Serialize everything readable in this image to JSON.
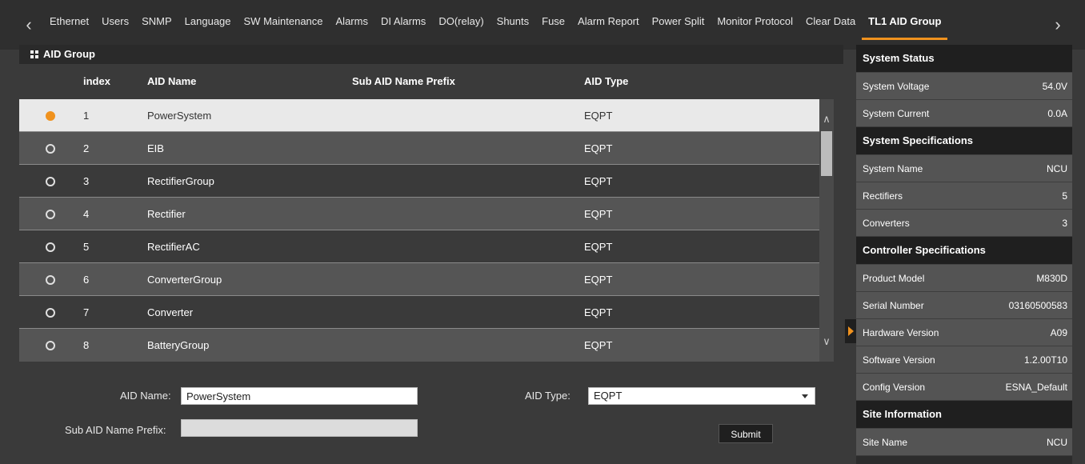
{
  "tabs": [
    {
      "label": "Ethernet"
    },
    {
      "label": "Users"
    },
    {
      "label": "SNMP"
    },
    {
      "label": "Language"
    },
    {
      "label": "SW Maintenance"
    },
    {
      "label": "Alarms"
    },
    {
      "label": "DI Alarms"
    },
    {
      "label": "DO(relay)"
    },
    {
      "label": "Shunts"
    },
    {
      "label": "Fuse"
    },
    {
      "label": "Alarm Report"
    },
    {
      "label": "Power Split"
    },
    {
      "label": "Monitor Protocol"
    },
    {
      "label": "Clear Data"
    },
    {
      "label": "TL1 AID Group"
    }
  ],
  "active_tab": "TL1 AID Group",
  "accent_color": "#f0921e",
  "group": {
    "title": "AID Group",
    "columns": {
      "index": "index",
      "aid_name": "AID Name",
      "sub_prefix": "Sub AID Name Prefix",
      "aid_type": "AID Type"
    },
    "rows": [
      {
        "index": "1",
        "name": "PowerSystem",
        "prefix": "",
        "type": "EQPT"
      },
      {
        "index": "2",
        "name": "EIB",
        "prefix": "",
        "type": "EQPT"
      },
      {
        "index": "3",
        "name": "RectifierGroup",
        "prefix": "",
        "type": "EQPT"
      },
      {
        "index": "4",
        "name": "Rectifier",
        "prefix": "",
        "type": "EQPT"
      },
      {
        "index": "5",
        "name": "RectifierAC",
        "prefix": "",
        "type": "EQPT"
      },
      {
        "index": "6",
        "name": "ConverterGroup",
        "prefix": "",
        "type": "EQPT"
      },
      {
        "index": "7",
        "name": "Converter",
        "prefix": "",
        "type": "EQPT"
      },
      {
        "index": "8",
        "name": "BatteryGroup",
        "prefix": "",
        "type": "EQPT"
      }
    ],
    "selected_index": "1"
  },
  "form": {
    "aid_name_label": "AID Name:",
    "aid_name_value": "PowerSystem",
    "sub_prefix_label": "Sub AID Name Prefix:",
    "sub_prefix_value": "",
    "aid_type_label": "AID Type:",
    "aid_type_value": "EQPT",
    "submit_label": "Submit"
  },
  "side": {
    "system_status": {
      "title": "System Status",
      "rows": [
        {
          "label": "System Voltage",
          "value": "54.0V"
        },
        {
          "label": "System Current",
          "value": "0.0A"
        }
      ]
    },
    "system_specs": {
      "title": "System Specifications",
      "rows": [
        {
          "label": "System Name",
          "value": "NCU"
        },
        {
          "label": "Rectifiers",
          "value": "5"
        },
        {
          "label": "Converters",
          "value": "3"
        }
      ]
    },
    "controller_specs": {
      "title": "Controller Specifications",
      "rows": [
        {
          "label": "Product Model",
          "value": "M830D"
        },
        {
          "label": "Serial Number",
          "value": "03160500583"
        },
        {
          "label": "Hardware Version",
          "value": "A09"
        },
        {
          "label": "Software Version",
          "value": "1.2.00T10"
        },
        {
          "label": "Config Version",
          "value": "ESNA_Default"
        }
      ]
    },
    "site_info": {
      "title": "Site Information",
      "rows": [
        {
          "label": "Site Name",
          "value": "NCU"
        }
      ]
    }
  }
}
